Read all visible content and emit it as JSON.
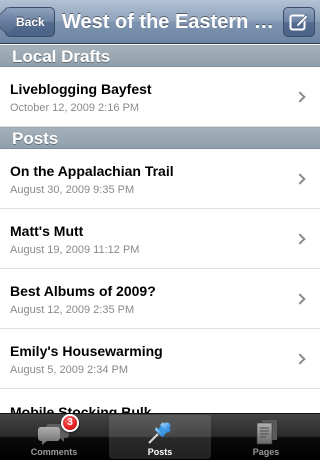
{
  "navbar": {
    "back_label": "Back",
    "title": "West of the Eastern Seaboard"
  },
  "sections": {
    "local_drafts": {
      "header": "Local Drafts",
      "items": [
        {
          "title": "Liveblogging Bayfest",
          "date": "October 12, 2009 2:16 PM"
        }
      ]
    },
    "posts": {
      "header": "Posts",
      "items": [
        {
          "title": "On the Appalachian Trail",
          "date": "August 30, 2009 9:35 PM"
        },
        {
          "title": "Matt's Mutt",
          "date": "August 19, 2009 11:12 PM"
        },
        {
          "title": "Best Albums of 2009?",
          "date": "August 12, 2009 2:35 PM"
        },
        {
          "title": "Emily's Housewarming",
          "date": "August 5, 2009 2:34 PM"
        },
        {
          "title": "Mobile Stocking Bulk",
          "date": ""
        }
      ]
    }
  },
  "tabbar": {
    "tabs": [
      {
        "label": "Comments",
        "icon": "speech-bubbles-icon",
        "badge": "3"
      },
      {
        "label": "Posts",
        "icon": "pushpin-icon",
        "selected": true
      },
      {
        "label": "Pages",
        "icon": "pages-icon"
      }
    ]
  },
  "colors": {
    "navbar": "#7e94b0",
    "section_header": "#909fab",
    "tabbar": "#000000",
    "badge": "#e02020",
    "date_text": "#8a8a8a"
  }
}
